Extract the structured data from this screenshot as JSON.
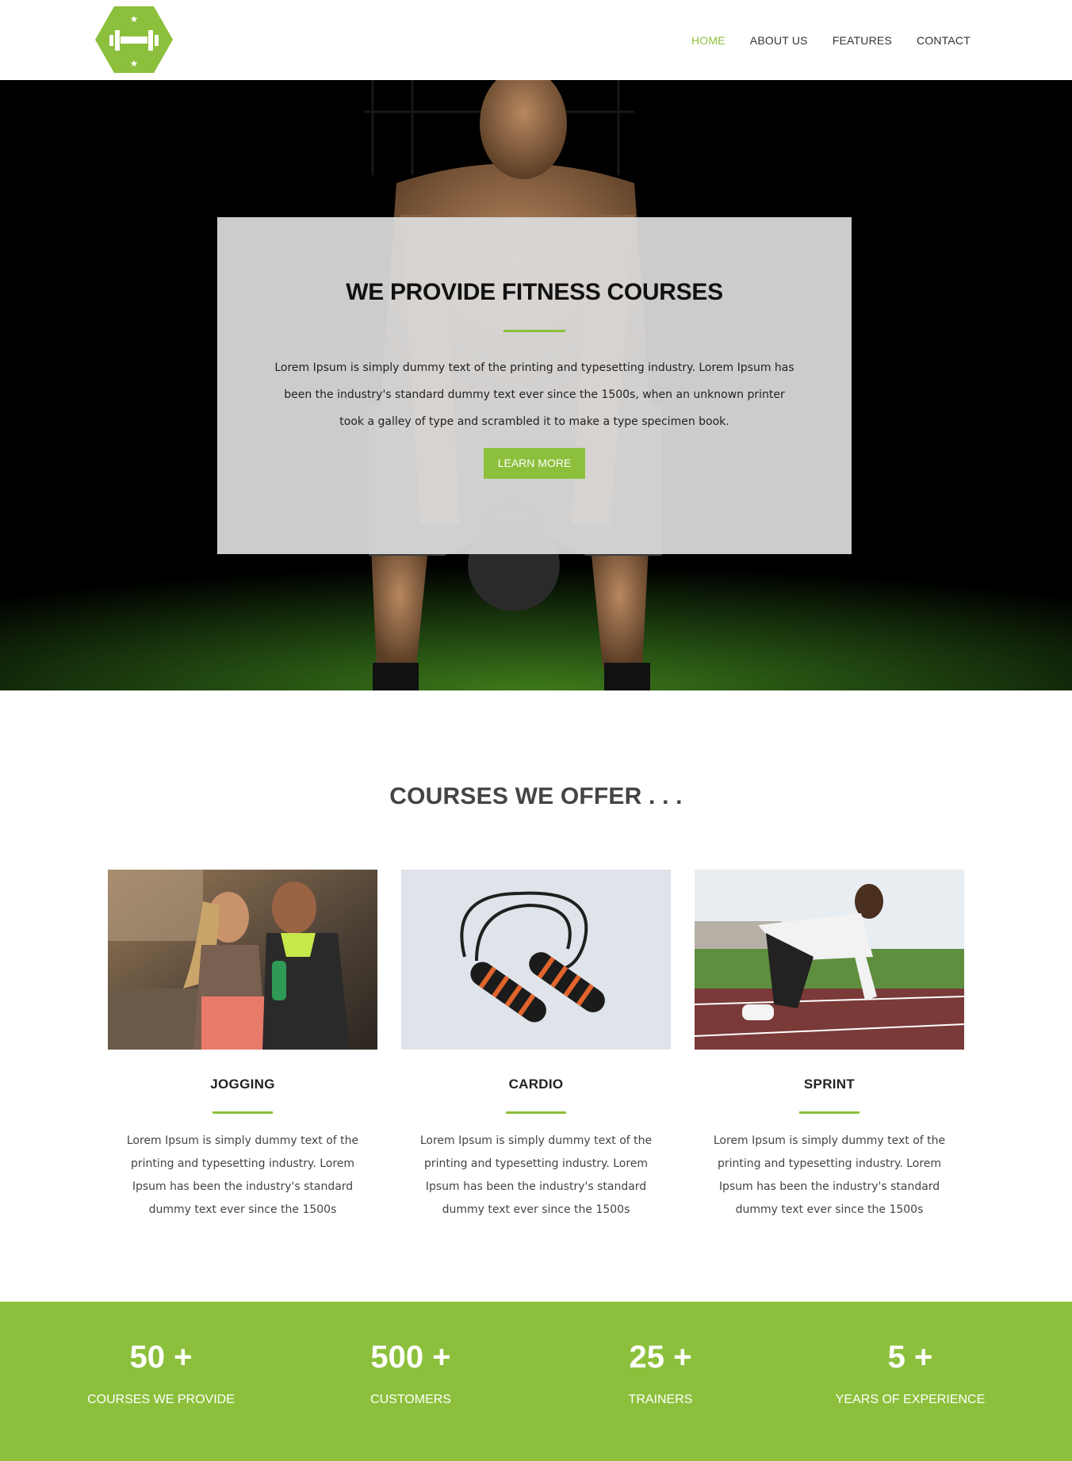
{
  "nav": {
    "items": [
      {
        "label": "HOME",
        "active": true
      },
      {
        "label": "ABOUT US",
        "active": false
      },
      {
        "label": "FEATURES",
        "active": false
      },
      {
        "label": "CONTACT",
        "active": false
      }
    ]
  },
  "hero": {
    "title": "WE PROVIDE FITNESS COURSES",
    "text": "Lorem Ipsum is simply dummy text of the printing and typesetting industry. Lorem Ipsum has been the industry's standard dummy text ever since the 1500s, when an unknown printer took a galley of type and scrambled it to make a type specimen book.",
    "button": "LEARN MORE"
  },
  "courses": {
    "title": "COURSES WE OFFER . . .",
    "items": [
      {
        "name": "JOGGING",
        "text": "Lorem Ipsum is simply dummy text of the printing and typesetting industry. Lorem Ipsum has been the industry's standard dummy text ever since the 1500s"
      },
      {
        "name": "CARDIO",
        "text": "Lorem Ipsum is simply dummy text of the printing and typesetting industry. Lorem Ipsum has been the industry's standard dummy text ever since the 1500s"
      },
      {
        "name": "SPRINT",
        "text": "Lorem Ipsum is simply dummy text of the printing and typesetting industry. Lorem Ipsum has been the industry's standard dummy text ever since the 1500s"
      }
    ]
  },
  "stats": [
    {
      "value": "50 +",
      "label": "COURSES WE PROVIDE"
    },
    {
      "value": "500 +",
      "label": "CUSTOMERS"
    },
    {
      "value": "25 +",
      "label": "TRAINERS"
    },
    {
      "value": "5 +",
      "label": "YEARS OF EXPERIENCE"
    }
  ],
  "colors": {
    "accent": "#8cc03c",
    "text": "#333333"
  },
  "icons": {
    "logo": "dumbbell-hexagon-icon"
  }
}
